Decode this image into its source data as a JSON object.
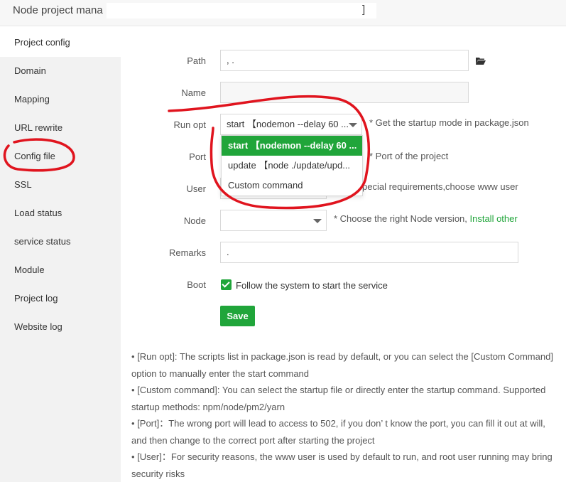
{
  "titlebar": {
    "title": "Node project mana",
    "bracket": "]"
  },
  "sidebar": {
    "items": [
      {
        "label": "Project config",
        "active": true
      },
      {
        "label": "Domain"
      },
      {
        "label": "Mapping"
      },
      {
        "label": "URL rewrite"
      },
      {
        "label": "Config file"
      },
      {
        "label": "SSL"
      },
      {
        "label": "Load status"
      },
      {
        "label": "service status"
      },
      {
        "label": "Module"
      },
      {
        "label": "Project log"
      },
      {
        "label": "Website log"
      }
    ]
  },
  "form": {
    "path": {
      "label": "Path",
      "value": ",        ."
    },
    "name": {
      "label": "Name",
      "value": ""
    },
    "run_opt": {
      "label": "Run opt",
      "value": "start  【nodemon --delay 60 ...",
      "hint": "* Get the startup mode in package.json"
    },
    "port": {
      "label": "Port",
      "hint": "* Port of the project"
    },
    "user": {
      "label": "User",
      "hint": "pecial requirements,choose www user"
    },
    "node": {
      "label": "Node",
      "value": "",
      "hint": "* Choose the right Node version, ",
      "link": "Install other"
    },
    "remarks": {
      "label": "Remarks",
      "value": "."
    },
    "boot": {
      "label": "Boot",
      "checkbox_label": "Follow the system to start the service",
      "checked": true
    },
    "save_label": "Save"
  },
  "dropdown": {
    "options": [
      {
        "label": "start  【nodemon --delay 60 ...",
        "selected": true
      },
      {
        "label": "update  【node ./update/upd..."
      },
      {
        "label": "Custom command"
      }
    ]
  },
  "notes": [
    "[Run opt]: The scripts list in package.json is read by default, or you can select the [Custom Command] option to manually enter the start command",
    "[Custom command]: You can select the startup file or directly enter the startup command. Supported startup methods: npm/node/pm2/yarn",
    "[Port]：The wrong port will lead to access to 502, if you don’ t know the port, you can fill it out at will, and then change to the correct port after starting the project",
    "[User]：For security reasons, the www user is used by default to run, and root user running may bring security risks"
  ],
  "colors": {
    "accent": "#20a53a",
    "annotation": "#e0141e"
  }
}
